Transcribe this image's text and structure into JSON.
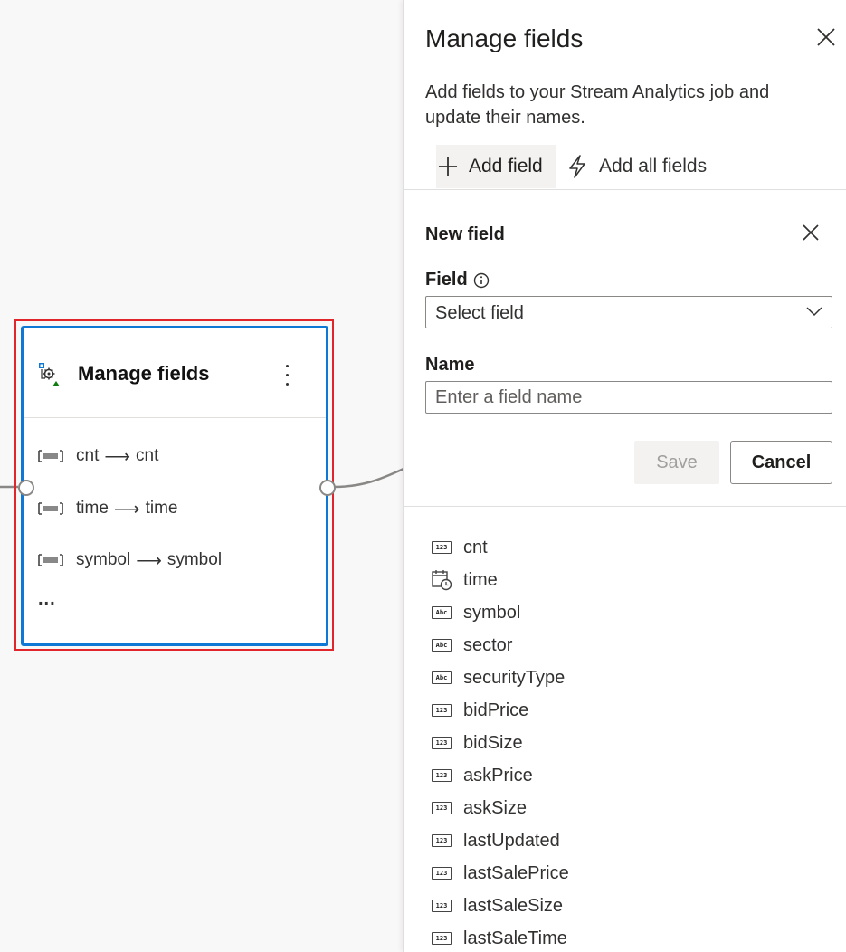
{
  "canvas": {
    "node": {
      "title": "Manage fields",
      "icon": "manage-fields-icon",
      "fields": [
        {
          "from": "cnt",
          "to": "cnt"
        },
        {
          "from": "time",
          "to": "time"
        },
        {
          "from": "symbol",
          "to": "symbol"
        }
      ],
      "arrow": "⟶",
      "more": "..."
    },
    "colors": {
      "highlight": "#e0262b",
      "node_border": "#0f78d4"
    }
  },
  "panel": {
    "title": "Manage fields",
    "description": "Add fields to your Stream Analytics job and update their names.",
    "commands": {
      "add_field": "Add field",
      "add_all_fields": "Add all fields"
    },
    "new_field": {
      "title": "New field",
      "field_label": "Field",
      "field_select_value": "Select field",
      "name_label": "Name",
      "name_placeholder": "Enter a field name",
      "save_label": "Save",
      "cancel_label": "Cancel"
    },
    "fields": [
      {
        "name": "cnt",
        "type": "number",
        "icon": "123"
      },
      {
        "name": "time",
        "type": "datetime",
        "icon": "calendar-clock-icon"
      },
      {
        "name": "symbol",
        "type": "string",
        "icon": "Abc"
      },
      {
        "name": "sector",
        "type": "string",
        "icon": "Abc"
      },
      {
        "name": "securityType",
        "type": "string",
        "icon": "Abc"
      },
      {
        "name": "bidPrice",
        "type": "number",
        "icon": "123"
      },
      {
        "name": "bidSize",
        "type": "number",
        "icon": "123"
      },
      {
        "name": "askPrice",
        "type": "number",
        "icon": "123"
      },
      {
        "name": "askSize",
        "type": "number",
        "icon": "123"
      },
      {
        "name": "lastUpdated",
        "type": "number",
        "icon": "123"
      },
      {
        "name": "lastSalePrice",
        "type": "number",
        "icon": "123"
      },
      {
        "name": "lastSaleSize",
        "type": "number",
        "icon": "123"
      },
      {
        "name": "lastSaleTime",
        "type": "number",
        "icon": "123"
      }
    ]
  }
}
